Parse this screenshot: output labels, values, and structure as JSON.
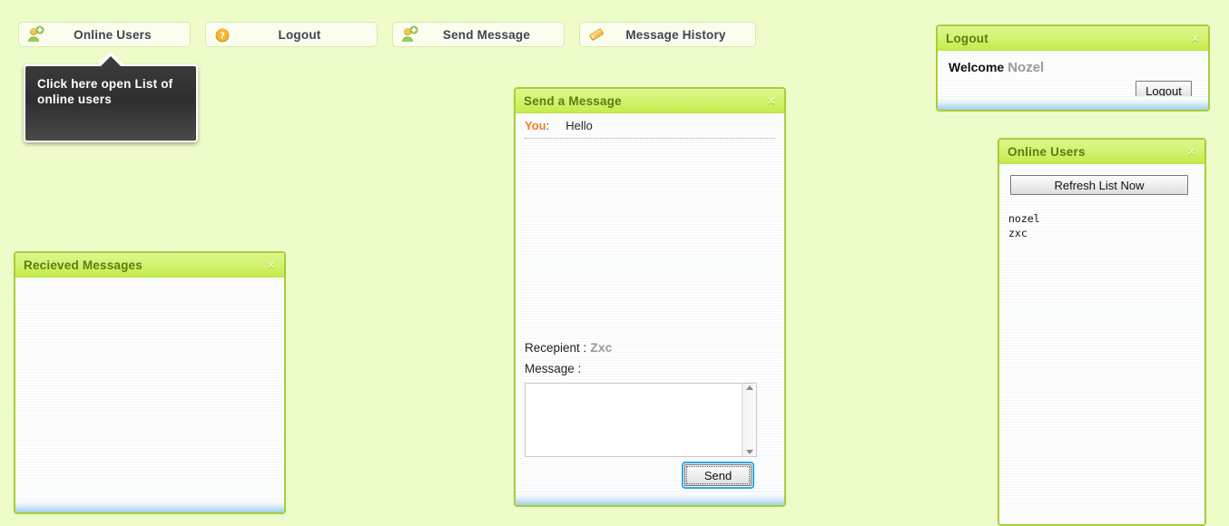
{
  "toolbar": {
    "buttons": [
      {
        "label": "Online Users",
        "icon": "user-add-icon"
      },
      {
        "label": "Logout",
        "icon": "question-mark-icon"
      },
      {
        "label": "Send Message",
        "icon": "user-add-icon"
      },
      {
        "label": "Message History",
        "icon": "tag-icon"
      }
    ]
  },
  "tooltip": {
    "text": "Click here open List of online users"
  },
  "received_panel": {
    "title": "Recieved Messages",
    "close_label": "×",
    "messages": []
  },
  "send_panel": {
    "title": "Send a Message",
    "close_label": "×",
    "chat": [
      {
        "sender": "You",
        "separator": ":",
        "text": "Hello"
      }
    ],
    "recipient_label": "Recepient :",
    "recipient_name": "Zxc",
    "message_label": "Message :",
    "message_value": "",
    "send_button_label": "Send"
  },
  "logout_panel": {
    "title": "Logout",
    "close_label": "×",
    "welcome_label": "Welcome",
    "user_name": "Nozel",
    "button_label": "Logout"
  },
  "online_panel": {
    "title": "Online Users",
    "close_label": "×",
    "refresh_button_label": "Refresh List Now",
    "users": [
      "nozel",
      "zxc"
    ]
  },
  "colors": {
    "page_background": "#eefcca",
    "panel_border": "#a5cf36",
    "header_gradient_top": "#ddf68f",
    "header_gradient_bottom": "#c4ec4b",
    "panel_title_text": "#5d7a14",
    "chat_sender": "#f47c20",
    "muted_name": "#9a9a9a",
    "tooltip_background": "#3a3a3a",
    "focus_ring": "#34a6e0"
  }
}
